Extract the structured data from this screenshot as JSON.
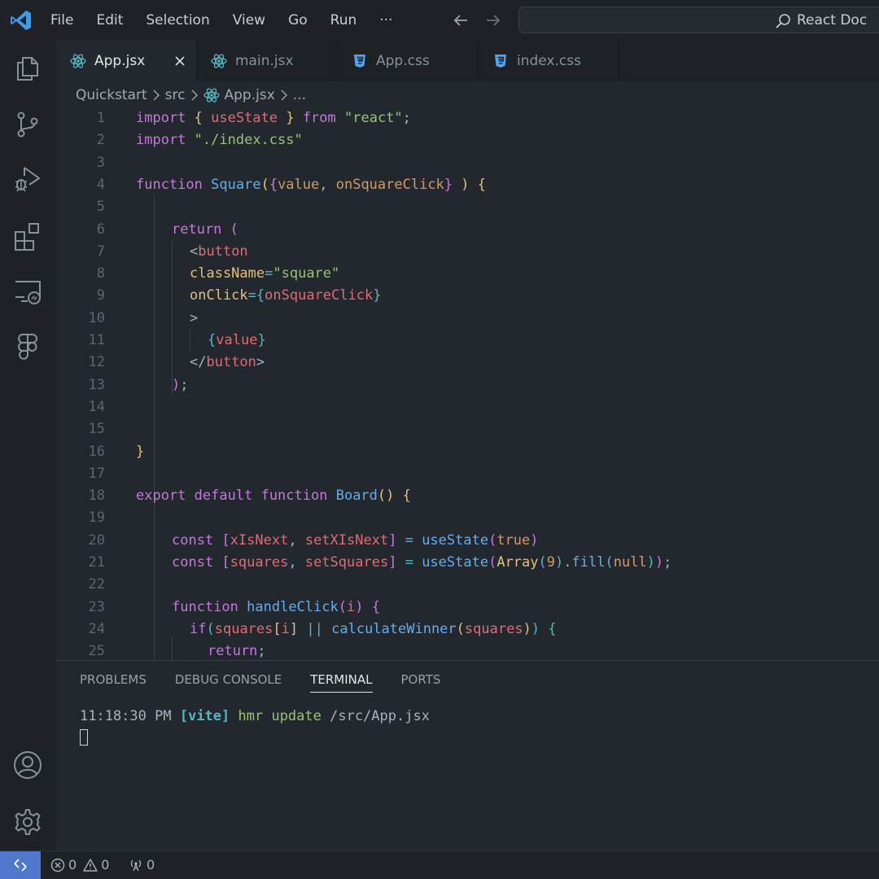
{
  "menu": [
    "File",
    "Edit",
    "Selection",
    "View",
    "Go",
    "Run",
    "···"
  ],
  "search": {
    "text": "React Doc"
  },
  "tabs": [
    {
      "label": "App.jsx",
      "icon": "react-icon",
      "active": true
    },
    {
      "label": "main.jsx",
      "icon": "react-icon",
      "active": false
    },
    {
      "label": "App.css",
      "icon": "css-icon",
      "active": false
    },
    {
      "label": "index.css",
      "icon": "css-icon",
      "active": false
    }
  ],
  "breadcrumb": [
    "Quickstart",
    "src",
    "App.jsx",
    "..."
  ],
  "editor": {
    "lines": [
      {
        "n": 1,
        "indent": 0,
        "tokens": [
          [
            "import",
            "k"
          ],
          [
            " ",
            "p"
          ],
          [
            "{",
            "b1"
          ],
          [
            " ",
            "p"
          ],
          [
            "useState",
            "v"
          ],
          [
            " ",
            "p"
          ],
          [
            "}",
            "b1"
          ],
          [
            " ",
            "p"
          ],
          [
            "from",
            "k"
          ],
          [
            " ",
            "p"
          ],
          [
            "\"react\"",
            "s"
          ],
          [
            ";",
            "p"
          ]
        ]
      },
      {
        "n": 2,
        "indent": 0,
        "tokens": [
          [
            "import",
            "k"
          ],
          [
            " ",
            "p"
          ],
          [
            "\"./index.css\"",
            "s"
          ]
        ]
      },
      {
        "n": 3,
        "indent": 0,
        "tokens": []
      },
      {
        "n": 4,
        "indent": 0,
        "tokens": [
          [
            "function",
            "k"
          ],
          [
            " ",
            "p"
          ],
          [
            "Square",
            "f"
          ],
          [
            "(",
            "b1"
          ],
          [
            "{",
            "b2"
          ],
          [
            "value",
            "n"
          ],
          [
            ", ",
            "p"
          ],
          [
            "onSquareClick",
            "n"
          ],
          [
            "}",
            "b2"
          ],
          [
            " ",
            "p"
          ],
          [
            ")",
            "b1"
          ],
          [
            " ",
            "p"
          ],
          [
            "{",
            "b1"
          ]
        ]
      },
      {
        "n": 5,
        "indent": 0,
        "tokens": []
      },
      {
        "n": 6,
        "indent": 2,
        "tokens": [
          [
            "return",
            "k"
          ],
          [
            " ",
            "p"
          ],
          [
            "(",
            "b2"
          ]
        ]
      },
      {
        "n": 7,
        "indent": 3,
        "tokens": [
          [
            "<",
            "p"
          ],
          [
            "button",
            "t"
          ]
        ]
      },
      {
        "n": 8,
        "indent": 3,
        "tokens": [
          [
            "className",
            "a"
          ],
          [
            "=",
            "o"
          ],
          [
            "\"square\"",
            "s"
          ]
        ]
      },
      {
        "n": 9,
        "indent": 3,
        "tokens": [
          [
            "onClick",
            "a"
          ],
          [
            "=",
            "o"
          ],
          [
            "{",
            "b3"
          ],
          [
            "onSquareClick",
            "v"
          ],
          [
            "}",
            "b3"
          ]
        ]
      },
      {
        "n": 10,
        "indent": 3,
        "tokens": [
          [
            ">",
            "p"
          ]
        ]
      },
      {
        "n": 11,
        "indent": 4,
        "tokens": [
          [
            "{",
            "b3"
          ],
          [
            "value",
            "v"
          ],
          [
            "}",
            "b3"
          ]
        ]
      },
      {
        "n": 12,
        "indent": 3,
        "tokens": [
          [
            "</",
            "p"
          ],
          [
            "button",
            "t"
          ],
          [
            ">",
            "p"
          ]
        ]
      },
      {
        "n": 13,
        "indent": 2,
        "tokens": [
          [
            ")",
            "b2"
          ],
          [
            ";",
            "p"
          ]
        ]
      },
      {
        "n": 14,
        "indent": 0,
        "tokens": []
      },
      {
        "n": 15,
        "indent": 0,
        "tokens": []
      },
      {
        "n": 16,
        "indent": 0,
        "tokens": [
          [
            "}",
            "b1"
          ]
        ]
      },
      {
        "n": 17,
        "indent": 0,
        "tokens": []
      },
      {
        "n": 18,
        "indent": 0,
        "tokens": [
          [
            "export",
            "k"
          ],
          [
            " ",
            "p"
          ],
          [
            "default",
            "k"
          ],
          [
            " ",
            "p"
          ],
          [
            "function",
            "k"
          ],
          [
            " ",
            "p"
          ],
          [
            "Board",
            "f"
          ],
          [
            "()",
            "b1"
          ],
          [
            " ",
            "p"
          ],
          [
            "{",
            "b1"
          ]
        ]
      },
      {
        "n": 19,
        "indent": 0,
        "tokens": []
      },
      {
        "n": 20,
        "indent": 2,
        "tokens": [
          [
            "const",
            "k"
          ],
          [
            " ",
            "p"
          ],
          [
            "[",
            "b2"
          ],
          [
            "xIsNext",
            "v"
          ],
          [
            ", ",
            "p"
          ],
          [
            "setXIsNext",
            "v"
          ],
          [
            "]",
            "b2"
          ],
          [
            " ",
            "p"
          ],
          [
            "=",
            "o"
          ],
          [
            " ",
            "p"
          ],
          [
            "useState",
            "f"
          ],
          [
            "(",
            "b2"
          ],
          [
            "true",
            "n"
          ],
          [
            ")",
            "b2"
          ]
        ]
      },
      {
        "n": 21,
        "indent": 2,
        "tokens": [
          [
            "const",
            "k"
          ],
          [
            " ",
            "p"
          ],
          [
            "[",
            "b2"
          ],
          [
            "squares",
            "v"
          ],
          [
            ", ",
            "p"
          ],
          [
            "setSquares",
            "v"
          ],
          [
            "]",
            "b2"
          ],
          [
            " ",
            "p"
          ],
          [
            "=",
            "o"
          ],
          [
            " ",
            "p"
          ],
          [
            "useState",
            "f"
          ],
          [
            "(",
            "b2"
          ],
          [
            "Array",
            "a"
          ],
          [
            "(",
            "b3"
          ],
          [
            "9",
            "n"
          ],
          [
            ")",
            "b3"
          ],
          [
            ".",
            "p"
          ],
          [
            "fill",
            "f"
          ],
          [
            "(",
            "b3"
          ],
          [
            "null",
            "n"
          ],
          [
            ")",
            "b3"
          ],
          [
            ")",
            "b2"
          ],
          [
            ";",
            "p"
          ]
        ]
      },
      {
        "n": 22,
        "indent": 0,
        "tokens": []
      },
      {
        "n": 23,
        "indent": 2,
        "tokens": [
          [
            "function",
            "k"
          ],
          [
            " ",
            "p"
          ],
          [
            "handleClick",
            "f"
          ],
          [
            "(",
            "b2"
          ],
          [
            "i",
            "v"
          ],
          [
            ")",
            "b2"
          ],
          [
            " ",
            "p"
          ],
          [
            "{",
            "b2"
          ]
        ]
      },
      {
        "n": 24,
        "indent": 3,
        "tokens": [
          [
            "if",
            "k"
          ],
          [
            "(",
            "b3"
          ],
          [
            "squares",
            "v"
          ],
          [
            "[",
            "b1"
          ],
          [
            "i",
            "v"
          ],
          [
            "]",
            "b1"
          ],
          [
            " ",
            "p"
          ],
          [
            "||",
            "o"
          ],
          [
            " ",
            "p"
          ],
          [
            "calculateWinner",
            "f"
          ],
          [
            "(",
            "b1"
          ],
          [
            "squares",
            "v"
          ],
          [
            ")",
            "b1"
          ],
          [
            ")",
            "b3"
          ],
          [
            " ",
            "p"
          ],
          [
            "{",
            "b3"
          ]
        ]
      },
      {
        "n": 25,
        "indent": 4,
        "tokens": [
          [
            "return",
            "k"
          ],
          [
            ";",
            "p"
          ]
        ]
      }
    ]
  },
  "panel": {
    "tabs": [
      {
        "label": "PROBLEMS",
        "active": false
      },
      {
        "label": "DEBUG CONSOLE",
        "active": false
      },
      {
        "label": "TERMINAL",
        "active": true
      },
      {
        "label": "PORTS",
        "active": false
      }
    ],
    "terminal": {
      "time": "11:18:30 PM",
      "tag": "[vite]",
      "msg": "hmr update",
      "path": "/src/App.jsx"
    }
  },
  "status": {
    "errors": "0",
    "warnings": "0",
    "ports": "0"
  },
  "colors": {
    "accent": "#4d78cc",
    "bg": "#23272e",
    "chrome": "#1e2227",
    "react": "#56b6c2",
    "css": "#4fa4f4"
  }
}
